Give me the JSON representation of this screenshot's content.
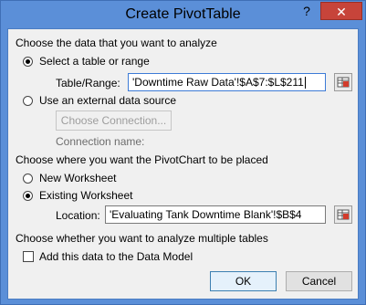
{
  "window": {
    "title": "Create PivotTable",
    "help_glyph": "?",
    "close_glyph": "✕"
  },
  "section_data": {
    "heading": "Choose the data that you want to analyze",
    "select_table_label": "Select a table or range",
    "table_range_label": "Table/Range:",
    "table_range_value": "'Downtime Raw Data'!$A$7:$L$211",
    "external_source_label": "Use an external data source",
    "choose_connection_label": "Choose Connection...",
    "connection_name_label": "Connection name:"
  },
  "section_placement": {
    "heading": "Choose where you want the PivotChart to be placed",
    "new_worksheet_label": "New Worksheet",
    "existing_worksheet_label": "Existing Worksheet",
    "location_label": "Location:",
    "location_value": "'Evaluating Tank Downtime Blank'!$B$4"
  },
  "section_multiple": {
    "heading": "Choose whether you want to analyze multiple tables",
    "data_model_label": "Add this data to the Data Model",
    "data_model_checked": false
  },
  "buttons": {
    "ok": "OK",
    "cancel": "Cancel"
  }
}
